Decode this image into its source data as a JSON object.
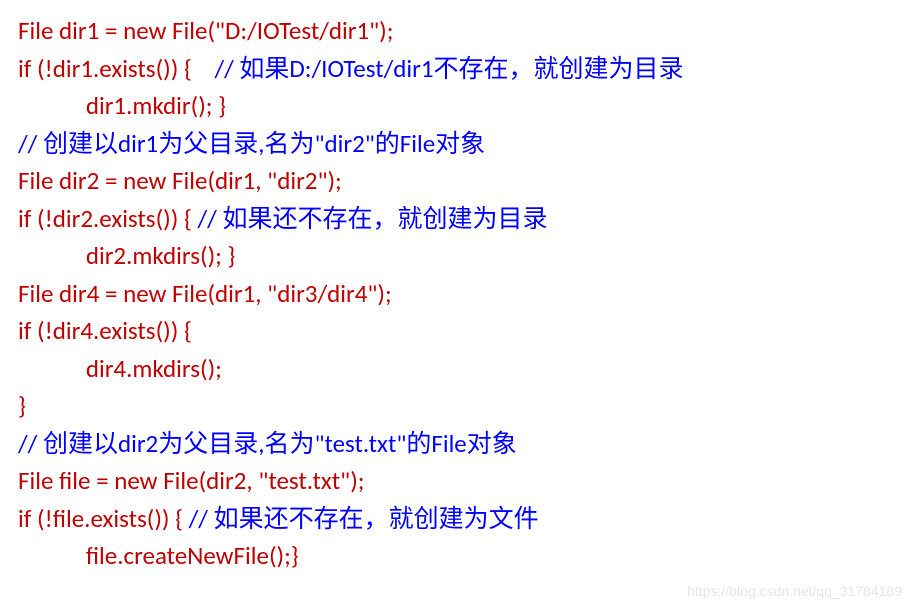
{
  "lines": {
    "l1_code": "File dir1 = new File(\"D:/IOTest/dir1\");",
    "l2_code": "if (!dir1.exists()) {    ",
    "l2_comment": "// 如果D:/IOTest/dir1不存在，就创建为目录",
    "l3_code": "            dir1.mkdir(); }",
    "l4_comment": "// 创建以dir1为父目录,名为\"dir2\"的File对象",
    "l5_code": "File dir2 = new File(dir1, \"dir2\");",
    "l6_code": "if (!dir2.exists()) { ",
    "l6_comment": "// 如果还不存在，就创建为目录",
    "l7_code": "            dir2.mkdirs(); }",
    "l8_code": "File dir4 = new File(dir1, \"dir3/dir4\");",
    "l9_code": "if (!dir4.exists()) {",
    "l10_code": "            dir4.mkdirs();",
    "l11_code": "}",
    "l12_comment": "// 创建以dir2为父目录,名为\"test.txt\"的File对象",
    "l13_code": "File file = new File(dir2, \"test.txt\");",
    "l14_code": "if (!file.exists()) { ",
    "l14_comment": "// 如果还不存在，就创建为文件",
    "l15_code": "            file.createNewFile();}"
  },
  "watermark": "https://blog.csdn.net/qq_31784189"
}
